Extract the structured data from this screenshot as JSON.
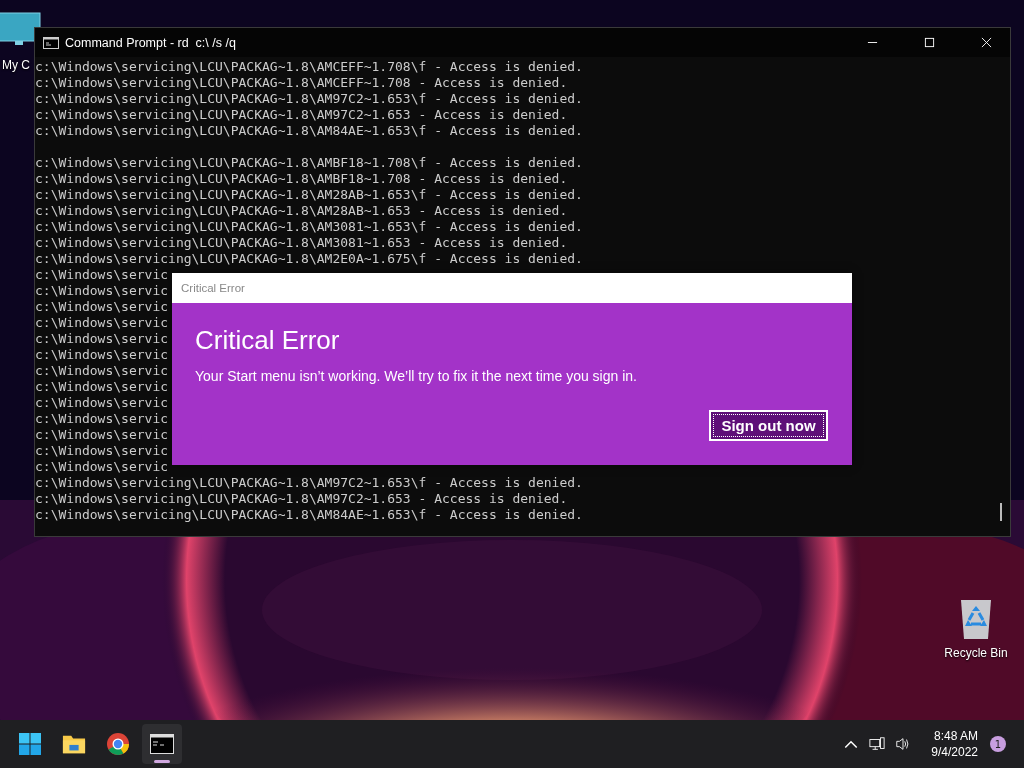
{
  "desktop_icons": [
    {
      "kind": "computer",
      "label": "My C"
    },
    {
      "kind": "recycle_bin",
      "label": "Recycle Bin"
    }
  ],
  "console_window": {
    "title": "Command Prompt - rd  c:\\ /s /q",
    "blocks": [
      [
        "c:\\Windows\\servicing\\LCU\\PACKAG~1.8\\AMCEFF~1.708\\f - Access is denied.",
        "c:\\Windows\\servicing\\LCU\\PACKAG~1.8\\AMCEFF~1.708 - Access is denied.",
        "c:\\Windows\\servicing\\LCU\\PACKAG~1.8\\AM97C2~1.653\\f - Access is denied.",
        "c:\\Windows\\servicing\\LCU\\PACKAG~1.8\\AM97C2~1.653 - Access is denied.",
        "c:\\Windows\\servicing\\LCU\\PACKAG~1.8\\AM84AE~1.653\\f - Access is denied."
      ],
      [
        "c:\\Windows\\servicing\\LCU\\PACKAG~1.8\\AMBF18~1.708\\f - Access is denied.",
        "c:\\Windows\\servicing\\LCU\\PACKAG~1.8\\AMBF18~1.708 - Access is denied.",
        "c:\\Windows\\servicing\\LCU\\PACKAG~1.8\\AM28AB~1.653\\f - Access is denied.",
        "c:\\Windows\\servicing\\LCU\\PACKAG~1.8\\AM28AB~1.653 - Access is denied.",
        "c:\\Windows\\servicing\\LCU\\PACKAG~1.8\\AM3081~1.653\\f - Access is denied.",
        "c:\\Windows\\servicing\\LCU\\PACKAG~1.8\\AM3081~1.653 - Access is denied.",
        "c:\\Windows\\servicing\\LCU\\PACKAG~1.8\\AM2E0A~1.675\\f - Access is denied.",
        "c:\\Windows\\servic",
        "c:\\Windows\\servic",
        "c:\\Windows\\servic",
        "c:\\Windows\\servic",
        "c:\\Windows\\servic",
        "c:\\Windows\\servic",
        "c:\\Windows\\servic",
        "c:\\Windows\\servic",
        "c:\\Windows\\servic",
        "c:\\Windows\\servic",
        "c:\\Windows\\servic",
        "c:\\Windows\\servic",
        "c:\\Windows\\servic",
        "c:\\Windows\\servicing\\LCU\\PACKAG~1.8\\AM97C2~1.653\\f - Access is denied.",
        "c:\\Windows\\servicing\\LCU\\PACKAG~1.8\\AM97C2~1.653 - Access is denied.",
        "c:\\Windows\\servicing\\LCU\\PACKAG~1.8\\AM84AE~1.653\\f - Access is denied."
      ]
    ]
  },
  "dialog": {
    "window_title": "Critical Error",
    "heading": "Critical Error",
    "message": "Your Start menu isn’t working. We’ll try to fix it the next time you sign in.",
    "button": "Sign out now"
  },
  "taskbar": {
    "items": [
      {
        "kind": "start",
        "selected": false
      },
      {
        "kind": "explorer",
        "selected": false
      },
      {
        "kind": "chrome",
        "selected": false
      },
      {
        "kind": "terminal",
        "selected": true
      }
    ],
    "time": "8:48 AM",
    "date": "9/4/2022",
    "notification_count": "1"
  }
}
